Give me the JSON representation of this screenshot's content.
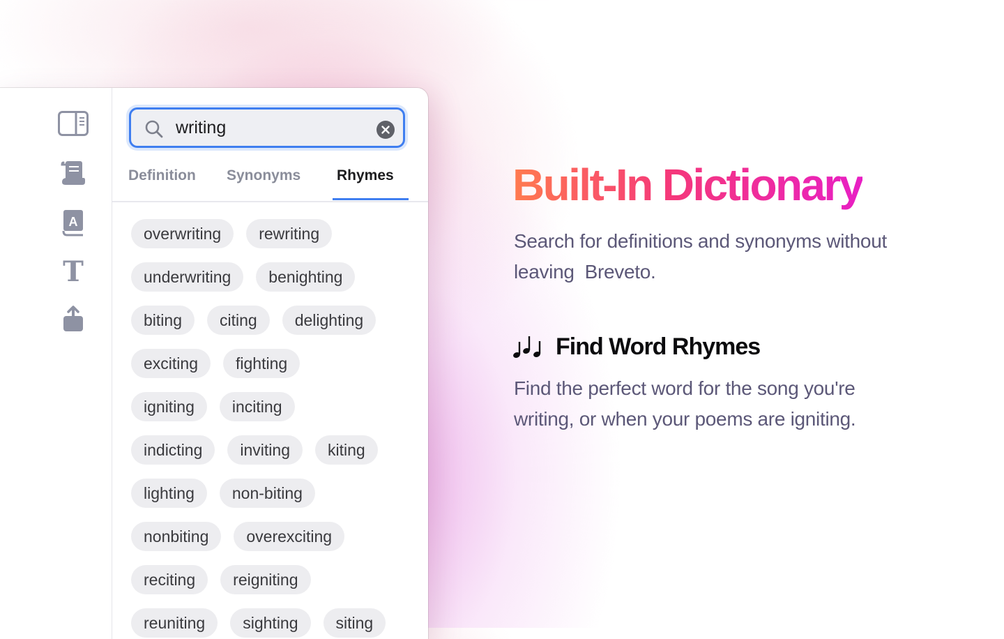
{
  "app": {
    "rail": {
      "items": [
        {
          "icon": "sidebar-toggle-icon"
        },
        {
          "icon": "scroll-document-icon"
        },
        {
          "icon": "dictionary-book-icon"
        },
        {
          "icon": "text-format-icon"
        },
        {
          "icon": "share-icon"
        }
      ]
    },
    "search": {
      "value": "writing",
      "placeholder": "Search"
    },
    "tabs": [
      {
        "label": "Definition",
        "active": false
      },
      {
        "label": "Synonyms",
        "active": false
      },
      {
        "label": "Rhymes",
        "active": true
      }
    ],
    "rhyme_rows": [
      [
        "overwriting",
        "rewriting"
      ],
      [
        "underwriting",
        "benighting"
      ],
      [
        "biting",
        "citing",
        "delighting"
      ],
      [
        "exciting",
        "fighting"
      ],
      [
        "igniting",
        "inciting"
      ],
      [
        "indicting",
        "inviting",
        "kiting"
      ],
      [
        "lighting",
        "non-biting"
      ],
      [
        "nonbiting",
        "overexciting"
      ],
      [
        "reciting",
        "reigniting"
      ],
      [
        "reuniting",
        "sighting",
        "siting"
      ]
    ]
  },
  "marketing": {
    "headline": "Built-In Dictionary",
    "description": "Search for definitions and synonyms without leaving  Breveto.",
    "feature": {
      "icon": "music-notes-icon",
      "title": "Find Word Rhymes",
      "description": "Find the perfect word for the song you're writing, or when your poems are igniting."
    }
  },
  "colors": {
    "accent": "#3f7ef0",
    "headline_gradient": [
      "#ff7b4f",
      "#f5387a",
      "#e81fc4"
    ],
    "body_text": "#5c5878"
  }
}
